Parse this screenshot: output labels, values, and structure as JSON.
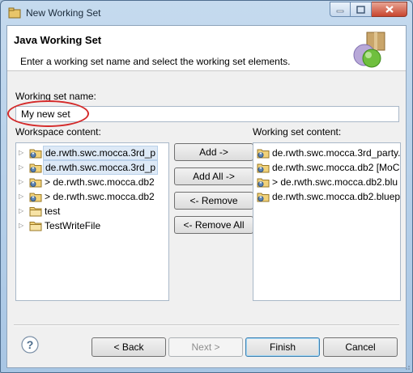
{
  "window": {
    "title": "New Working Set"
  },
  "header": {
    "title": "Java Working Set",
    "description": "Enter a working set name and select the working set elements."
  },
  "name_field": {
    "label": "Working set name:",
    "value": "My new set"
  },
  "workspace": {
    "label": "Workspace content:",
    "items": [
      {
        "text": "de.rwth.swc.mocca.3rd_p",
        "expander": "▷",
        "icon": "java-project-icon",
        "selected": true
      },
      {
        "text": "de.rwth.swc.mocca.3rd_p",
        "expander": "▷",
        "icon": "java-project-icon",
        "selected": true
      },
      {
        "text": "> de.rwth.swc.mocca.db2",
        "expander": "▷",
        "icon": "java-project-icon",
        "selected": false
      },
      {
        "text": "> de.rwth.swc.mocca.db2",
        "expander": "▷",
        "icon": "java-project-icon",
        "selected": false
      },
      {
        "text": "test",
        "expander": "▷",
        "icon": "folder-icon",
        "selected": false
      },
      {
        "text": "TestWriteFile",
        "expander": "▷",
        "icon": "folder-icon",
        "selected": false
      }
    ]
  },
  "buttons": {
    "add": "Add ->",
    "add_all": "Add All ->",
    "remove": "<- Remove",
    "remove_all": "<- Remove All"
  },
  "working_set": {
    "label": "Working set content:",
    "items": [
      {
        "text": "de.rwth.swc.mocca.3rd_party.",
        "icon": "java-project-icon"
      },
      {
        "text": "de.rwth.swc.mocca.db2 [MoC",
        "icon": "java-project-icon"
      },
      {
        "text": "> de.rwth.swc.mocca.db2.blu",
        "icon": "java-project-icon"
      },
      {
        "text": "de.rwth.swc.mocca.db2.bluep",
        "icon": "java-project-icon"
      }
    ]
  },
  "footer": {
    "back": "< Back",
    "next": "Next >",
    "finish": "Finish",
    "cancel": "Cancel"
  },
  "colors": {
    "highlight_ellipse": "#d42a2a",
    "selection": "#dde9f6",
    "close_button": "#c8452e"
  }
}
